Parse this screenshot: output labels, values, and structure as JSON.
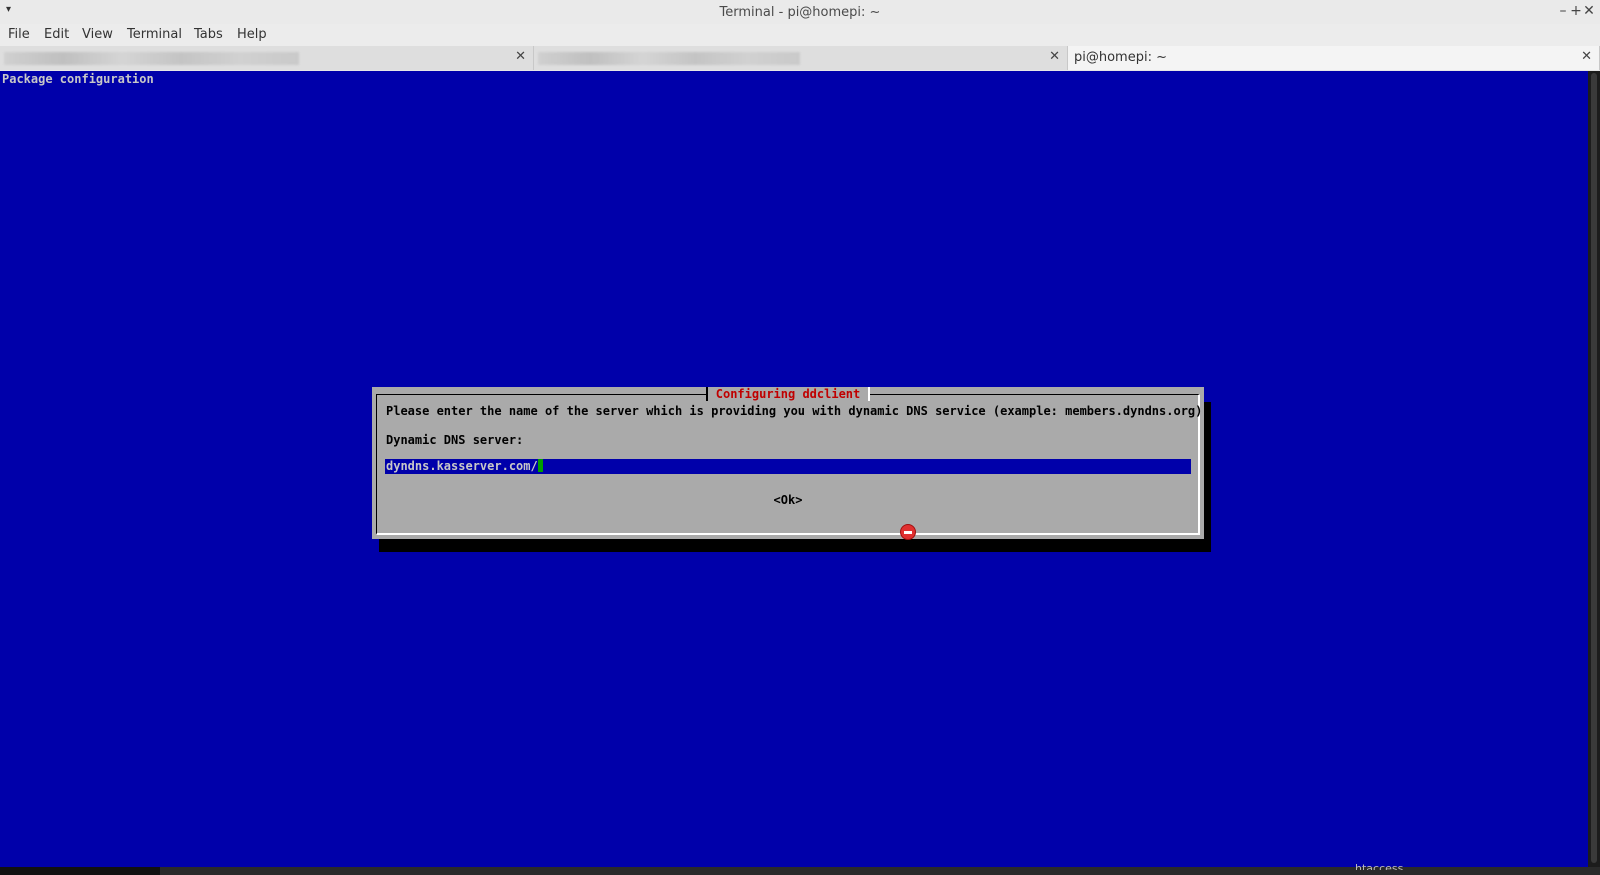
{
  "window": {
    "title": "Terminal - pi@homepi: ~",
    "menu_arrow": "▾",
    "minimize": "–",
    "maximize": "+",
    "close": "✕"
  },
  "menubar": {
    "items": [
      "File",
      "Edit",
      "View",
      "Terminal",
      "Tabs",
      "Help"
    ]
  },
  "tabs": [
    {
      "label": "",
      "blurred": true,
      "close": "✕"
    },
    {
      "label": "",
      "blurred": true,
      "close": "✕"
    },
    {
      "label": "pi@homepi: ~",
      "blurred": false,
      "close": "✕"
    }
  ],
  "terminal": {
    "header": "Package configuration",
    "dialog": {
      "title": "Configuring ddclient",
      "prompt": "Please enter the name of the server which is providing you with dynamic DNS service (example: members.dyndns.org).",
      "field_label": "Dynamic DNS server:",
      "field_value": "dyndns.kasserver.com/",
      "ok_label": "<Ok>"
    }
  },
  "statusbar": {
    "text": "htaccess"
  },
  "colors": {
    "terminal_bg": "#0000aa",
    "dialog_bg": "#aaaaaa",
    "dialog_title": "#c00000",
    "cursor": "#00a000"
  }
}
